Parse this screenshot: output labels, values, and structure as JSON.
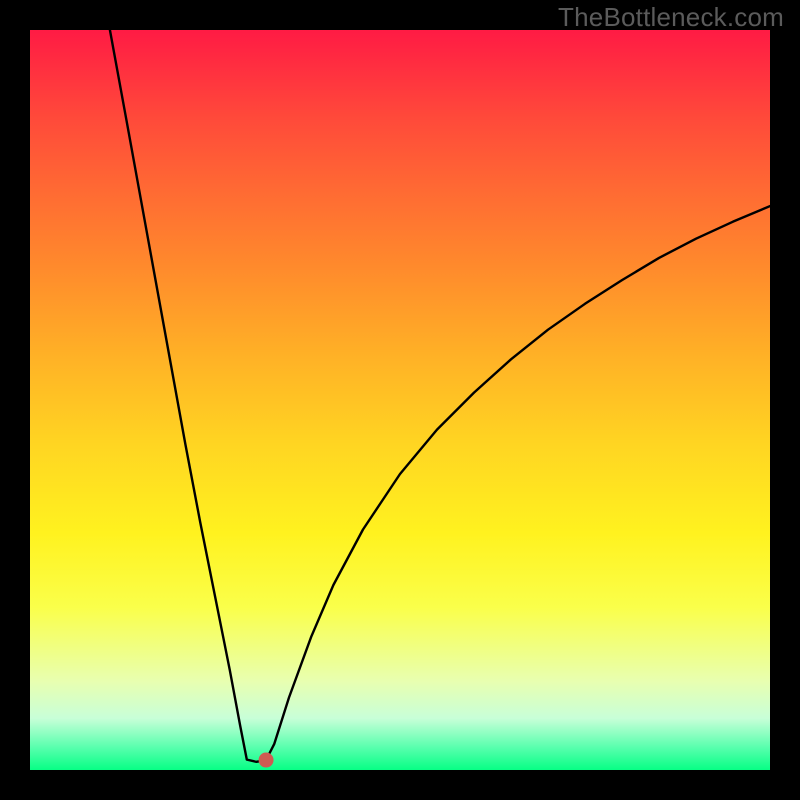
{
  "watermark": "TheBottleneck.com",
  "colors": {
    "curve_stroke": "#000000",
    "marker_fill": "#cf5b52",
    "frame_bg": "#000000"
  },
  "chart_data": {
    "type": "line",
    "title": "",
    "xlabel": "",
    "ylabel": "",
    "xlim": [
      0,
      100
    ],
    "ylim": [
      0,
      100
    ],
    "grid": false,
    "legend": false,
    "description": "Bottleneck curve: a V-shaped function of a single variable. The left branch descends almost linearly from near 100 at x≈11 to ≈0 at x≈29, has a short flat floor, then the right branch rises with diminishing slope toward ≈76 at x=100. Background gradient goes red (top, high) → yellow → green (bottom, low).",
    "marker": {
      "x": 31.9,
      "y": 1.35
    },
    "series": [
      {
        "name": "bottleneck",
        "points": [
          {
            "x": 10.8,
            "y": 100.0
          },
          {
            "x": 13.0,
            "y": 88.0
          },
          {
            "x": 15.0,
            "y": 77.0
          },
          {
            "x": 17.0,
            "y": 66.0
          },
          {
            "x": 19.0,
            "y": 55.0
          },
          {
            "x": 21.0,
            "y": 44.0
          },
          {
            "x": 23.0,
            "y": 33.5
          },
          {
            "x": 25.0,
            "y": 23.5
          },
          {
            "x": 27.0,
            "y": 13.5
          },
          {
            "x": 28.4,
            "y": 6.0
          },
          {
            "x": 29.3,
            "y": 1.4
          },
          {
            "x": 30.6,
            "y": 1.1
          },
          {
            "x": 31.9,
            "y": 1.35
          },
          {
            "x": 33.0,
            "y": 3.5
          },
          {
            "x": 35.0,
            "y": 9.8
          },
          {
            "x": 38.0,
            "y": 18.0
          },
          {
            "x": 41.0,
            "y": 25.0
          },
          {
            "x": 45.0,
            "y": 32.5
          },
          {
            "x": 50.0,
            "y": 40.0
          },
          {
            "x": 55.0,
            "y": 46.0
          },
          {
            "x": 60.0,
            "y": 51.0
          },
          {
            "x": 65.0,
            "y": 55.5
          },
          {
            "x": 70.0,
            "y": 59.5
          },
          {
            "x": 75.0,
            "y": 63.0
          },
          {
            "x": 80.0,
            "y": 66.2
          },
          {
            "x": 85.0,
            "y": 69.2
          },
          {
            "x": 90.0,
            "y": 71.8
          },
          {
            "x": 95.0,
            "y": 74.1
          },
          {
            "x": 100.0,
            "y": 76.2
          }
        ]
      }
    ]
  }
}
